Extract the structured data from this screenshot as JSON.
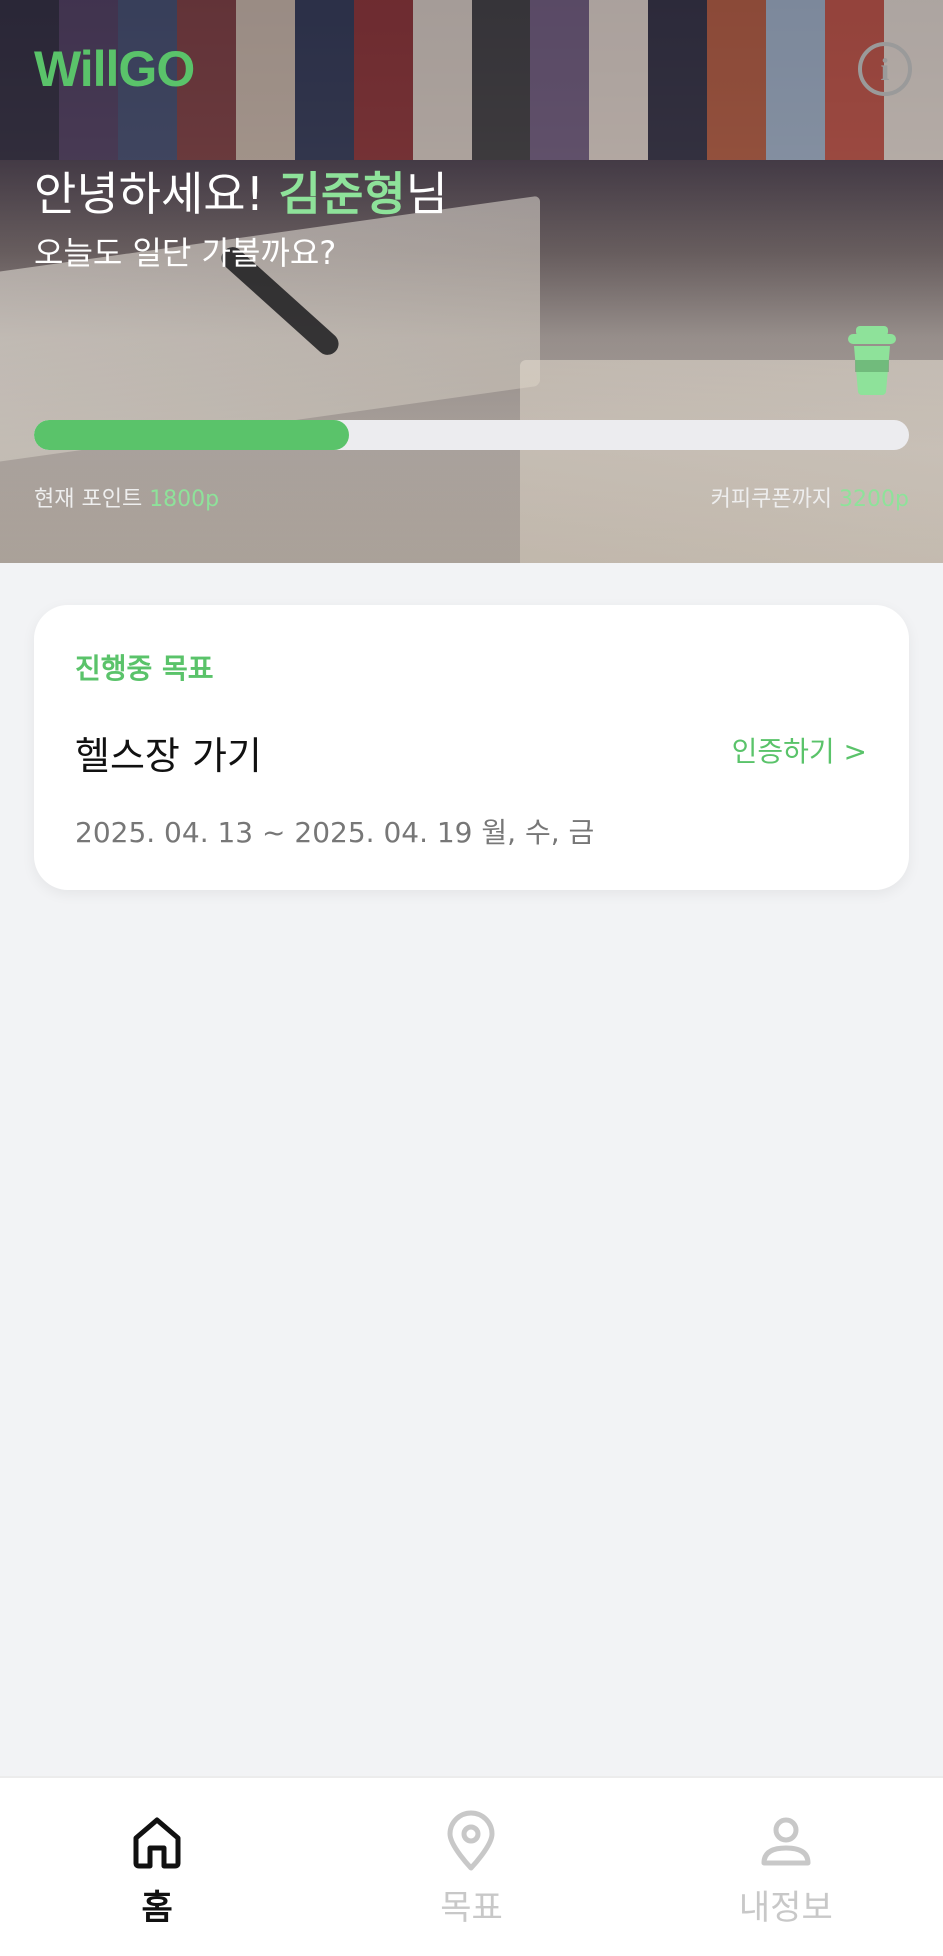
{
  "header": {
    "logo": "WillGO",
    "info_icon": "info-icon",
    "greeting_prefix": "안녕하세요! ",
    "user_name": "김준형",
    "greeting_suffix": "님",
    "sub_greeting": "오늘도 일단 가볼까요?",
    "coupon_icon": "coffee-cup-icon"
  },
  "points": {
    "current_label": "현재 포인트 ",
    "current_value": "1800p",
    "coupon_label": "커피쿠폰까지 ",
    "coupon_value": "3200p",
    "progress_fraction": 0.36
  },
  "goal_card": {
    "tag": "진행중 목표",
    "title": "헬스장 가기",
    "action": "인증하기 >",
    "date_range": "2025. 04. 13 ~ 2025. 04. 19 월, 수, 금"
  },
  "nav": {
    "items": [
      {
        "label": "홈",
        "icon": "home-icon",
        "active": true
      },
      {
        "label": "목표",
        "icon": "location-pin-icon",
        "active": false
      },
      {
        "label": "내정보",
        "icon": "user-icon",
        "active": false
      }
    ]
  },
  "colors": {
    "accent": "#5ac36a",
    "accent_light": "#8ee29a",
    "background": "#f2f3f5"
  }
}
